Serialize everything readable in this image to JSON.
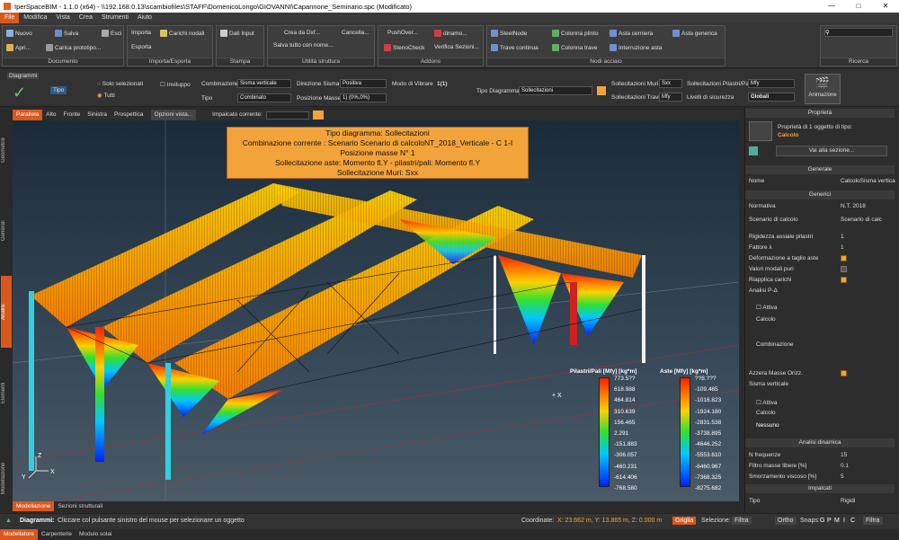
{
  "window": {
    "title": "IperSpaceBIM - 1.1.0 (x64) - \\\\192.168.0.13\\scambiofiles\\STAFF\\DomenicoLongo\\GIOVANNI\\Capannone_Seminario.spc (Modificato)",
    "minimize": "—",
    "maximize": "□",
    "close": "✕"
  },
  "menu": [
    "File",
    "Modifica",
    "Vista",
    "Crea",
    "Strumenti",
    "Aiuto"
  ],
  "ribbon": {
    "documento": {
      "label": "Documento",
      "nuovo": "Nuovo",
      "salva": "Salva",
      "esci": "Esci",
      "apri": "Apri...",
      "carica": "Carica prototipo..."
    },
    "importa": {
      "label": "Importa/Esporta",
      "importa": "Importa",
      "carichi": "Carichi nodali",
      "esporta": "Esporta"
    },
    "stampa": {
      "label": "Stampa",
      "dati": "Dati Input"
    },
    "utilita": {
      "label": "Utilità struttura",
      "crea": "Crea da Dxf...",
      "cancella": "Cancella...",
      "salva": "Salva tutto con nome..."
    },
    "addons": {
      "label": "Addons",
      "pushover": "PushOver...",
      "dinamo": "dinamo...",
      "stenocheck": "StenoCheck",
      "verifica": "Verifica Sezioni..."
    },
    "nodi": {
      "label": "Nodi acciaio",
      "steelnode": "SteelNode",
      "plinto": "Colonna plinto",
      "cerniera": "Asta cerniera",
      "generica": "Asta generica",
      "trave": "Trave continua",
      "colonnatrave": "Colonna trave",
      "interruzione": "Interruzione asta"
    },
    "ricerca": {
      "label": "Ricerca"
    }
  },
  "toolbar2": {
    "diagrammi": "Diagrammi",
    "tipo": "Tipo",
    "solo": "Solo selezionati",
    "tutti": "Tutti",
    "inviluppo": "Inviluppo",
    "combinazione": "Combinazione",
    "comb_val": "Sisma verticale",
    "tipo2": "Tipo",
    "tipo2_val": "Combinato",
    "dir_sisma": "Direzione Sisma",
    "dir_val": "Positiva",
    "pos_masse": "Posizione Masse",
    "pos_val": "1) (0%,0%)",
    "modo": "Modo di Vibrare",
    "modo_val": "1(1)",
    "tipo_diag": "Tipo Diagramma",
    "tipo_diag_val": "Sollecitazioni",
    "muri": "Sollecitazioni Muri",
    "muri_val": "Sxx",
    "pilastri": "Sollecitazioni Pilastri/Pali",
    "pilastri_val": "Mfy",
    "travi": "Sollecitazioni Travi",
    "travi_val": "Mfy",
    "livelli": "Livelli di sicurezza",
    "livelli_val": "Globali",
    "animazione": "Animazione"
  },
  "viewtabs": [
    "Parallela",
    "Alto",
    "Fronte",
    "Sinistra",
    "Prospettica"
  ],
  "opzioni": "Opzioni vista...",
  "impalcato": "Impalcato corrente:",
  "leftbar": [
    "Geometrie",
    "Generali",
    "Analisi",
    "Elementi",
    "Modellazione"
  ],
  "infobox": [
    "Tipo diagramma: Sollecitazioni",
    "Combinazione corrente : Scenario Scenario di calcoloNT_2018_Verticale - C 1-I",
    "Posizione masse N° 1",
    "Sollecitazione aste: Momento fl.Y - pilastri/pali: Momento fl.Y",
    "Sollecitazione Muri: Sxx"
  ],
  "legend": {
    "pilastri_title": "Pilastri/Pali [Mfy] [kg*m]",
    "pilastri": [
      "773.5??",
      "618.988",
      "464.814",
      "310.639",
      "156.465",
      "2.291",
      "-151.883",
      "-306.057",
      "-460.231",
      "-614.406",
      "-768.580"
    ],
    "aste_title": "Aste [Mfy] [kg*m]",
    "aste": [
      "??8.???",
      "-109.465",
      "-1016.823",
      "-1924.180",
      "-2831.538",
      "-3738.895",
      "-4646.252",
      "-5553.610",
      "-6460.967",
      "-7368.325",
      "-8275.682"
    ]
  },
  "axes": {
    "x": "X",
    "y": "Y",
    "z": "Z"
  },
  "bottomtabs": [
    "Modellazione",
    "Sezioni strutturali"
  ],
  "status": {
    "msg_bold": "Diagrammi:",
    "msg": "Cliccare col pulsante sinistro del mouse per selezionare un oggetto",
    "coord_label": "Coordinate:",
    "coord": "X: 23.662 m, Y: 13.865 m, Z: 0.000 m",
    "griglia": "Griglia",
    "selezione": "Selezione:",
    "filtra": "Filtra",
    "ortho": "Ortho",
    "snaps": "Snaps:",
    "snap_keys": [
      "G",
      "P",
      "M",
      "I",
      "C"
    ],
    "filtra2": "Filtra"
  },
  "btmtabs": [
    "Modellatore",
    "Carpenterie",
    "Modulo solai"
  ],
  "panel": {
    "title": "Proprietà",
    "desc": "Proprietà di 1 oggetto di tipo:",
    "type": "Calcolo",
    "vai": "Vai alla sezione...",
    "sec_generale": "Generale",
    "nome_k": "Nome",
    "nome_v": "CalcoloSisma vertica",
    "sec_generici": "Generici",
    "normativa_k": "Normativa",
    "normativa_v": "N.T. 2018",
    "scenario_k": "Scenario di calcolo",
    "scenario_v": "Scenario di calc",
    "rigidezza_k": "Rigidezza assiale pilastri",
    "rigidezza_v": "1",
    "fattore_k": "Fattore λ",
    "fattore_v": "1",
    "deform_k": "Deformazione a taglio aste",
    "valori_k": "Valori modali puri",
    "riapplica_k": "Riapplica carichi",
    "pdelta": "Analisi P-Δ",
    "attiva": "Attiva",
    "calcolo": "Calcolo",
    "combinazione": "Combinazione",
    "azzera_k": "Azzera Masse Orizz.",
    "sisma_v": "Sisma verticale",
    "attiva2": "Attiva",
    "calcolo2": "Calcolo",
    "nessuno": "Nessuno",
    "sec_dinamica": "Analisi dinamica",
    "nfreq_k": "N frequenze",
    "nfreq_v": "15",
    "filtro_k": "Filtro masse libere [%]",
    "filtro_v": "0.1",
    "smorz_k": "Smorzamento viscoso [%]",
    "smorz_v": "5",
    "sec_impalcati": "Impalcati",
    "tipo_k": "Tipo",
    "tipo_v": "Rigidi"
  },
  "colors": {
    "accent": "#d9581c",
    "info": "#f2a33a"
  }
}
